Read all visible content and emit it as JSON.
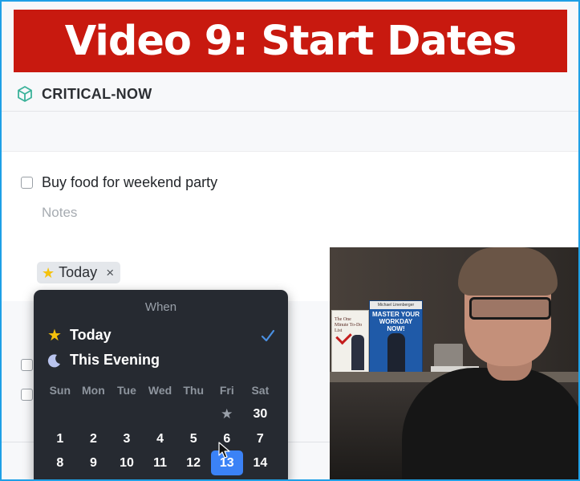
{
  "banner": {
    "title": "Video 9: Start Dates"
  },
  "header": {
    "area_icon": "area-cube-icon",
    "title": "CRITICAL-NOW"
  },
  "task": {
    "title": "Buy food for weekend party",
    "notes_placeholder": "Notes",
    "when_tag": {
      "icon": "star-icon",
      "label": "Today",
      "remove_icon": "close-icon",
      "remove_glyph": "×"
    }
  },
  "when_popover": {
    "heading": "When",
    "options": [
      {
        "icon": "star-icon",
        "label": "Today",
        "selected": true
      },
      {
        "icon": "moon-icon",
        "label": "This Evening",
        "selected": false
      }
    ],
    "weekdays": [
      "Sun",
      "Mon",
      "Tue",
      "Wed",
      "Thu",
      "Fri",
      "Sat"
    ],
    "weeks": [
      [
        "",
        "",
        "",
        "",
        "",
        "★",
        "30"
      ],
      [
        "1",
        "2",
        "3",
        "4",
        "5",
        "6",
        "7"
      ],
      [
        "8",
        "9",
        "10",
        "11",
        "12",
        "13",
        "14"
      ]
    ],
    "selected_day": "13",
    "colors": {
      "accent": "#3b82f6",
      "popover_bg": "#262a31",
      "today_star": "#f5c20c"
    }
  },
  "video_overlay": {
    "book1_title": "The One Minute To-Do List",
    "book2_author": "Michael Linenberger",
    "book2_title": "MASTER YOUR WORKDAY NOW!"
  },
  "colors": {
    "banner": "#c8190f",
    "frame_border": "#1ea0e6"
  }
}
